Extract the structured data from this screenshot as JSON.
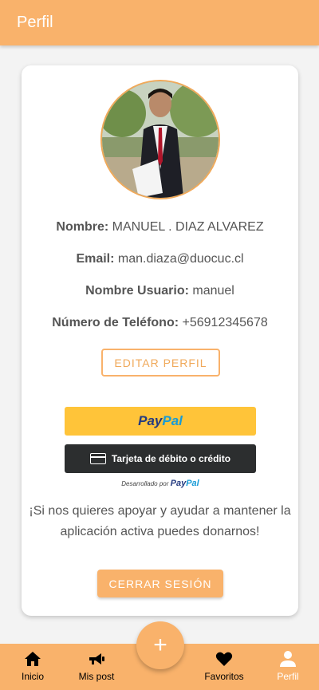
{
  "header": {
    "title": "Perfil"
  },
  "profile": {
    "name_label": "Nombre:",
    "name_value": "MANUEL . DIAZ ALVAREZ",
    "email_label": "Email:",
    "email_value": "man.diaza@duocuc.cl",
    "username_label": "Nombre Usuario:",
    "username_value": "manuel",
    "phone_label": "Número de Teléfono:",
    "phone_value": "+56912345678"
  },
  "buttons": {
    "edit": "EDITAR PERFIL",
    "paypal_pay": "Pay",
    "paypal_pal": "Pal",
    "card": "Tarjeta de débito o crédito",
    "logout": "CERRAR SESIÓN"
  },
  "powered_by": {
    "prefix": "Desarrollado por",
    "pay": "Pay",
    "pal": "Pal"
  },
  "donate_text_line1": "¡Si nos quieres apoyar y ayudar a mantener la",
  "donate_text_line2": "aplicación activa puedes donarnos!",
  "fab": {
    "icon": "plus-icon",
    "label": "+"
  },
  "tabs": [
    {
      "label": "Inicio",
      "icon": "home-icon"
    },
    {
      "label": "Mis post",
      "icon": "megaphone-icon"
    },
    {
      "label": "Favoritos",
      "icon": "heart-icon"
    },
    {
      "label": "Perfil",
      "icon": "person-icon",
      "active": true
    }
  ],
  "colors": {
    "accent": "#f9b26b",
    "paypal_yellow": "#ffc439",
    "card_dark": "#2c2e2f"
  }
}
